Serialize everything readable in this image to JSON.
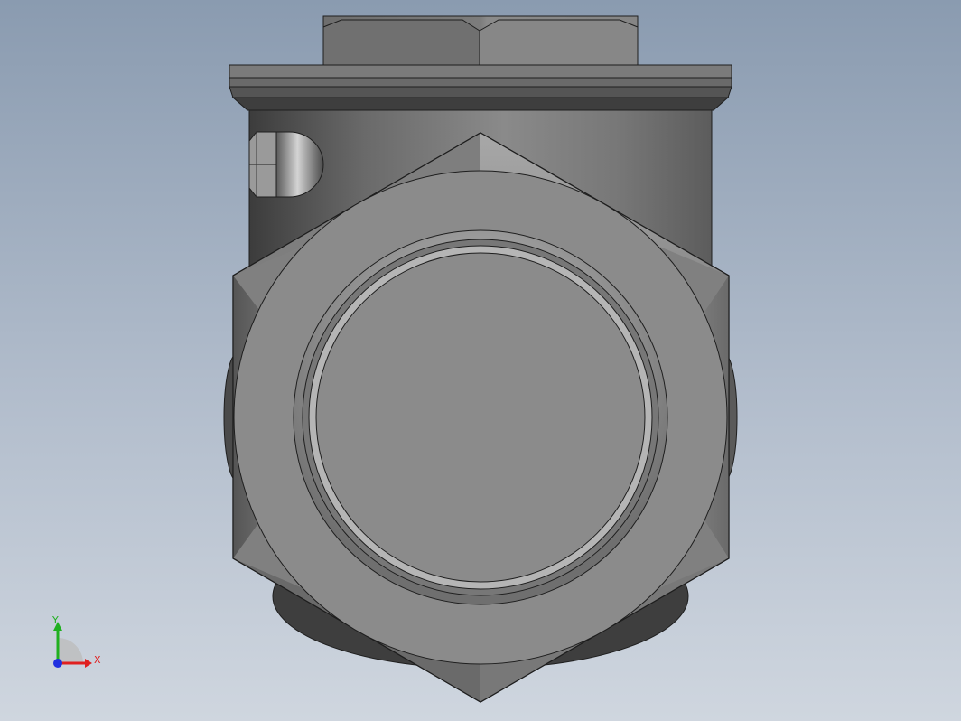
{
  "viewport": {
    "background_top": "#8a9bb0",
    "background_bottom": "#cfd6df"
  },
  "model": {
    "body_color": "#8c8c8c",
    "edge_color": "#1e1e1e",
    "highlight_color": "#d0d0d0"
  },
  "triad": {
    "x_label": "X",
    "y_label": "Y",
    "x_color": "#e02020",
    "y_color": "#20b020",
    "z_color": "#2030e0"
  }
}
